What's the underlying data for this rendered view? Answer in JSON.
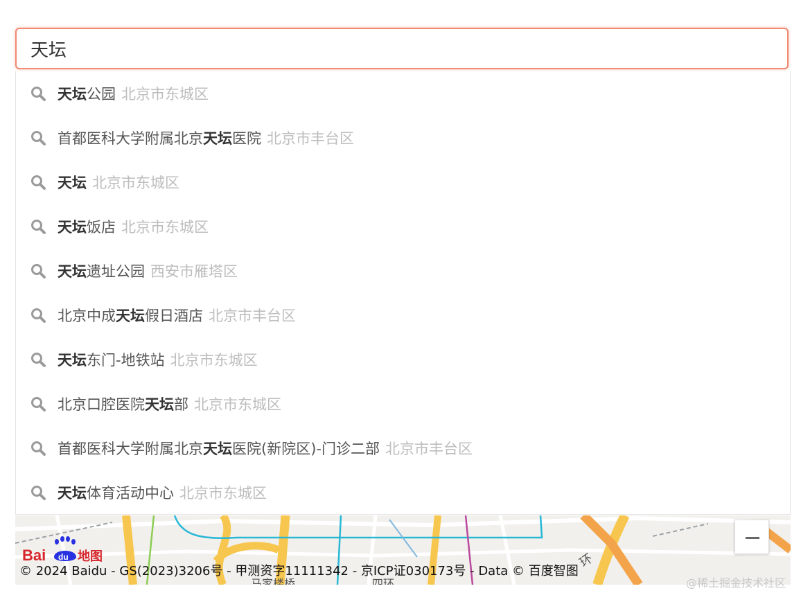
{
  "search": {
    "value": "天坛",
    "accent_color": "#f08a72"
  },
  "suggestions": [
    {
      "before": "",
      "match": "天坛",
      "after": "公园",
      "region": "北京市东城区"
    },
    {
      "before": "首都医科大学附属北京",
      "match": "天坛",
      "after": "医院",
      "region": "北京市丰台区"
    },
    {
      "before": "",
      "match": "天坛",
      "after": "",
      "region": "北京市东城区"
    },
    {
      "before": "",
      "match": "天坛",
      "after": "饭店",
      "region": "北京市东城区"
    },
    {
      "before": "",
      "match": "天坛",
      "after": "遗址公园",
      "region": "西安市雁塔区"
    },
    {
      "before": "北京中成",
      "match": "天坛",
      "after": "假日酒店",
      "region": "北京市丰台区"
    },
    {
      "before": "",
      "match": "天坛",
      "after": "东门-地铁站",
      "region": "北京市东城区"
    },
    {
      "before": "北京口腔医院",
      "match": "天坛",
      "after": "部",
      "region": "北京市东城区"
    },
    {
      "before": "首都医科大学附属北京",
      "match": "天坛",
      "after": "医院(新院区)-门诊二部",
      "region": "北京市丰台区"
    },
    {
      "before": "",
      "match": "天坛",
      "after": "体育活动中心",
      "region": "北京市东城区"
    }
  ],
  "suggestion_icon": "search-icon",
  "map": {
    "copyright": "© 2024 Baidu - GS(2023)3206号 - 甲测资字11111342 - 京ICP证030173号 - Data © 百度智图",
    "logo_text_bai": "Bai",
    "logo_text_du": "du",
    "logo_text_map": "地图",
    "zoom_out_icon": "minus-icon",
    "road_labels": [
      "环",
      "马家楼桥",
      "四环"
    ]
  },
  "watermark": "@稀土掘金技术社区"
}
